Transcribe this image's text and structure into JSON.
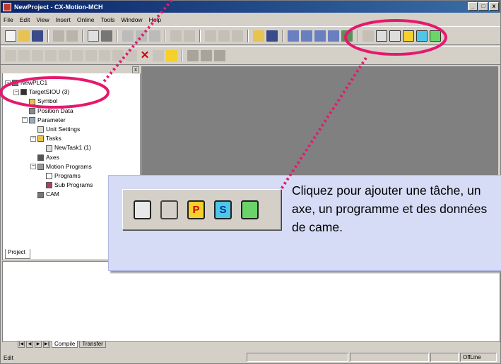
{
  "window": {
    "title": "NewProject - CX-Motion-MCH",
    "min": "_",
    "max": "□",
    "close": "x"
  },
  "menu": [
    "File",
    "Edit",
    "View",
    "Insert",
    "Online",
    "Tools",
    "Window",
    "Help"
  ],
  "tree": {
    "root": "NewPLC1",
    "target": "TargetSIOU (3)",
    "symbol": "Symbol",
    "position_data": "Position Data",
    "parameter": "Parameter",
    "unit_settings": "Unit Settings",
    "tasks": "Tasks",
    "new_task": "NewTask1 (1)",
    "axes": "Axes",
    "motion_programs": "Motion Programs",
    "programs": "Programs",
    "sub_programs": "Sub Programs",
    "cam": "CAM"
  },
  "project_tab": "Project",
  "output_tabs": {
    "compile": "Compile",
    "transfer": "Transfer"
  },
  "status": {
    "left": "Edit",
    "mode": "OffLine"
  },
  "callout": {
    "text": "Cliquez pour ajouter une tâche, un axe, un programme et des données de came.",
    "icons": [
      "task-icon",
      "axis-icon",
      "p",
      "s",
      "cam-data-icon"
    ],
    "labels": {
      "p": "P",
      "s": "S"
    }
  },
  "colors": {
    "highlight": "#e6186e",
    "callout_bg": "#d6dcf5",
    "title_bar": "#0a246a"
  }
}
